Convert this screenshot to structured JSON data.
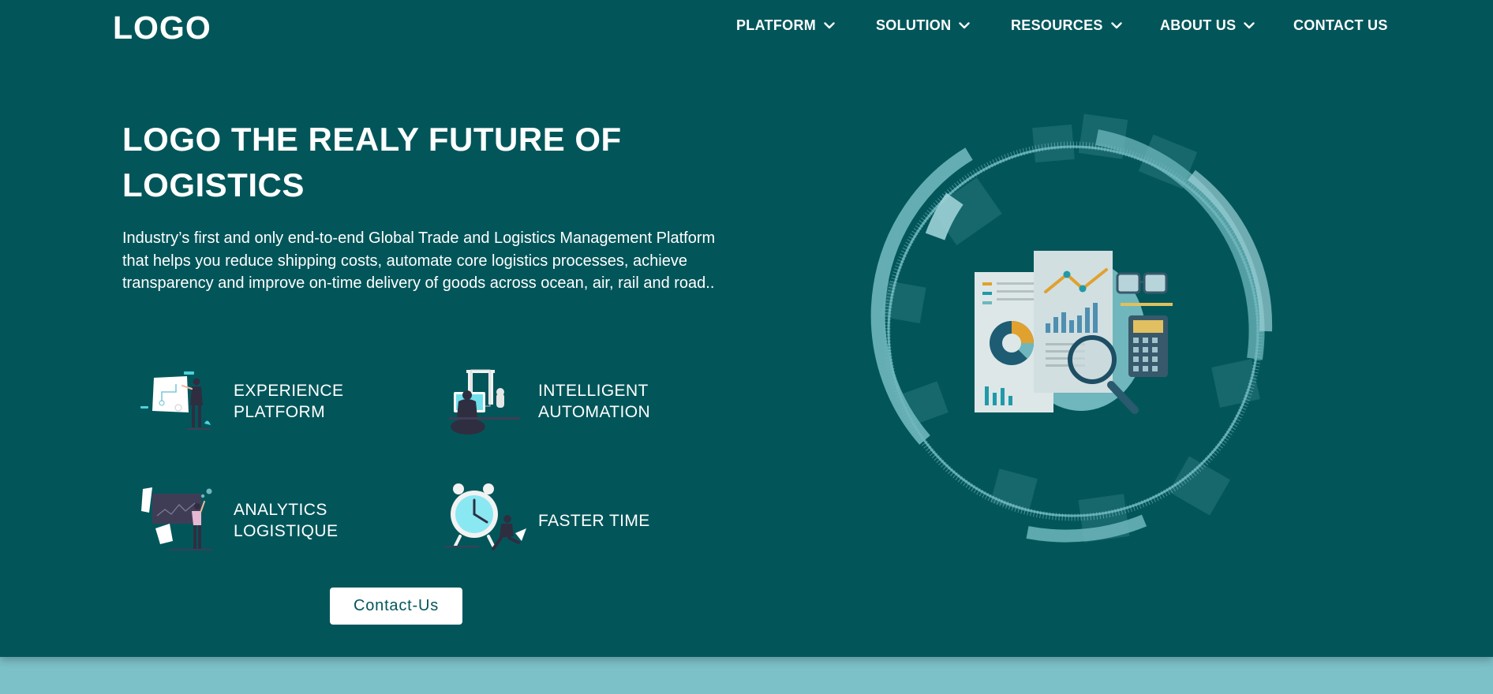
{
  "header": {
    "logo": "LOGO",
    "nav": [
      {
        "label": "PLATFORM",
        "has_dropdown": true
      },
      {
        "label": "SOLUTION",
        "has_dropdown": true
      },
      {
        "label": "RESOURCES",
        "has_dropdown": true
      },
      {
        "label": "ABOUT US",
        "has_dropdown": true
      },
      {
        "label": "CONTACT US",
        "has_dropdown": false
      }
    ]
  },
  "hero": {
    "title_line1": "LOGO THE REALY FUTURE OF",
    "title_line2": "LOGISTICS",
    "subtitle": "Industry’s first and only end-to-end Global Trade and Logistics Management Platform that helps you reduce shipping costs, automate core logistics processes, achieve transparency and improve on-time delivery of goods across ocean, air, rail and road..",
    "features": [
      {
        "line1": "EXPERIENCE",
        "line2": "PLATFORM",
        "icon": "whiteboard-presenter-illustration"
      },
      {
        "line1": "INTELLIGENT",
        "line2": "AUTOMATION",
        "icon": "robot-arm-desk-illustration"
      },
      {
        "line1": "ANALYTICS",
        "line2": "LOGISTIQUE",
        "icon": "chart-board-analyst-illustration"
      },
      {
        "line1": "FASTER TIME",
        "line2": "",
        "icon": "alarm-clock-runner-illustration"
      }
    ],
    "cta_label": "Contact-Us",
    "illustration": "analytics-documents-ring-illustration"
  },
  "colors": {
    "hero_bg": "#02565a",
    "page_bg": "#7cc1c8",
    "accent_teal": "#6fb7bc",
    "text": "#ffffff"
  }
}
